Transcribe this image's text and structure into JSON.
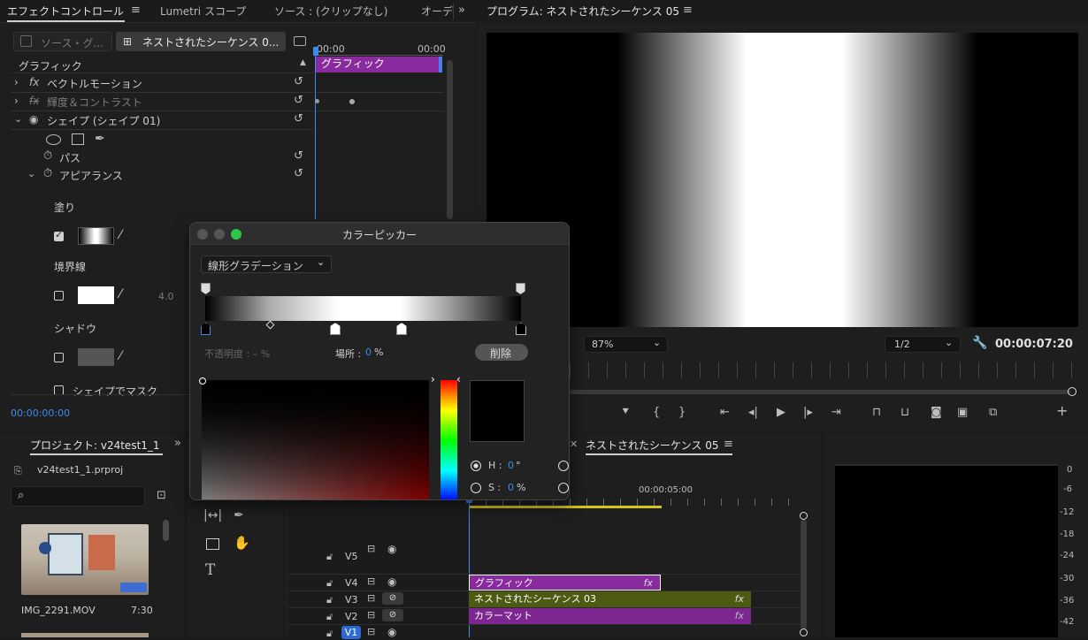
{
  "effect_controls": {
    "tabs": [
      "エフェクトコントロール",
      "Lumetri スコープ",
      "ソース : (クリップなし)",
      "オーデ"
    ],
    "source_tab": "ソース・グ...",
    "sequence_tab": "ネストされたシーケンス 0...",
    "section": "グラフィック",
    "timecode_start": "00:00",
    "timecode_end": "00:00",
    "clip_label": "グラフィック",
    "effects": [
      {
        "name": "ベクトルモーション",
        "fx": "fx",
        "expanded": false,
        "dim": false
      },
      {
        "name": "輝度＆コントラスト",
        "fx": "fx",
        "expanded": false,
        "dim": true
      },
      {
        "name": "シェイプ (シェイプ 01)",
        "fx": "",
        "expanded": true,
        "dim": false
      }
    ],
    "path_label": "パス",
    "appearance_label": "アピアランス",
    "fill_label": "塗り",
    "stroke_label": "境界線",
    "stroke_width": "4.0",
    "shadow_label": "シャドウ",
    "mask_label": "シェイプでマスク",
    "current_time": "00:00:00:00"
  },
  "program": {
    "title": "プログラム: ネストされたシーケンス 05",
    "zoom": "87%",
    "resolution": "1/2",
    "timecode": "00:00:07:20"
  },
  "color_picker": {
    "title": "カラーピッカー",
    "mode": "線形グラデーション",
    "opacity_label": "不透明度 : – %",
    "location_label": "場所 :",
    "location_value": "0",
    "location_unit": "%",
    "delete_label": "削除",
    "h_label": "H :",
    "h_value": "0",
    "h_unit": "°",
    "s_label": "S :",
    "s_value": "0",
    "s_unit": "%"
  },
  "project": {
    "title": "プロジェクト: v24test1_1",
    "file": "v24test1_1.prproj",
    "clip_name": "IMG_2291.MOV",
    "clip_duration": "7:30"
  },
  "timeline": {
    "title": "ネストされたシーケンス 05",
    "ruler_time": "00:00:05:00",
    "tracks": [
      "V5",
      "V4",
      "V3",
      "V2",
      "V1"
    ],
    "clips": [
      {
        "track": "V4",
        "name": "グラフィック",
        "fx": "fx"
      },
      {
        "track": "V3",
        "name": "ネストされたシーケンス 03",
        "fx": "fx"
      },
      {
        "track": "V2",
        "name": "カラーマット",
        "fx": "fx"
      }
    ]
  },
  "audio_meter": {
    "ticks": [
      "0",
      "-6",
      "-12",
      "-18",
      "-24",
      "-30",
      "-36",
      "-42"
    ]
  },
  "colors": {
    "accent_blue": "#3d8bf0",
    "clip_purple": "#8a2a9f",
    "clip_olive": "#4d5a12",
    "timeline_yellow": "#d5c21b"
  }
}
